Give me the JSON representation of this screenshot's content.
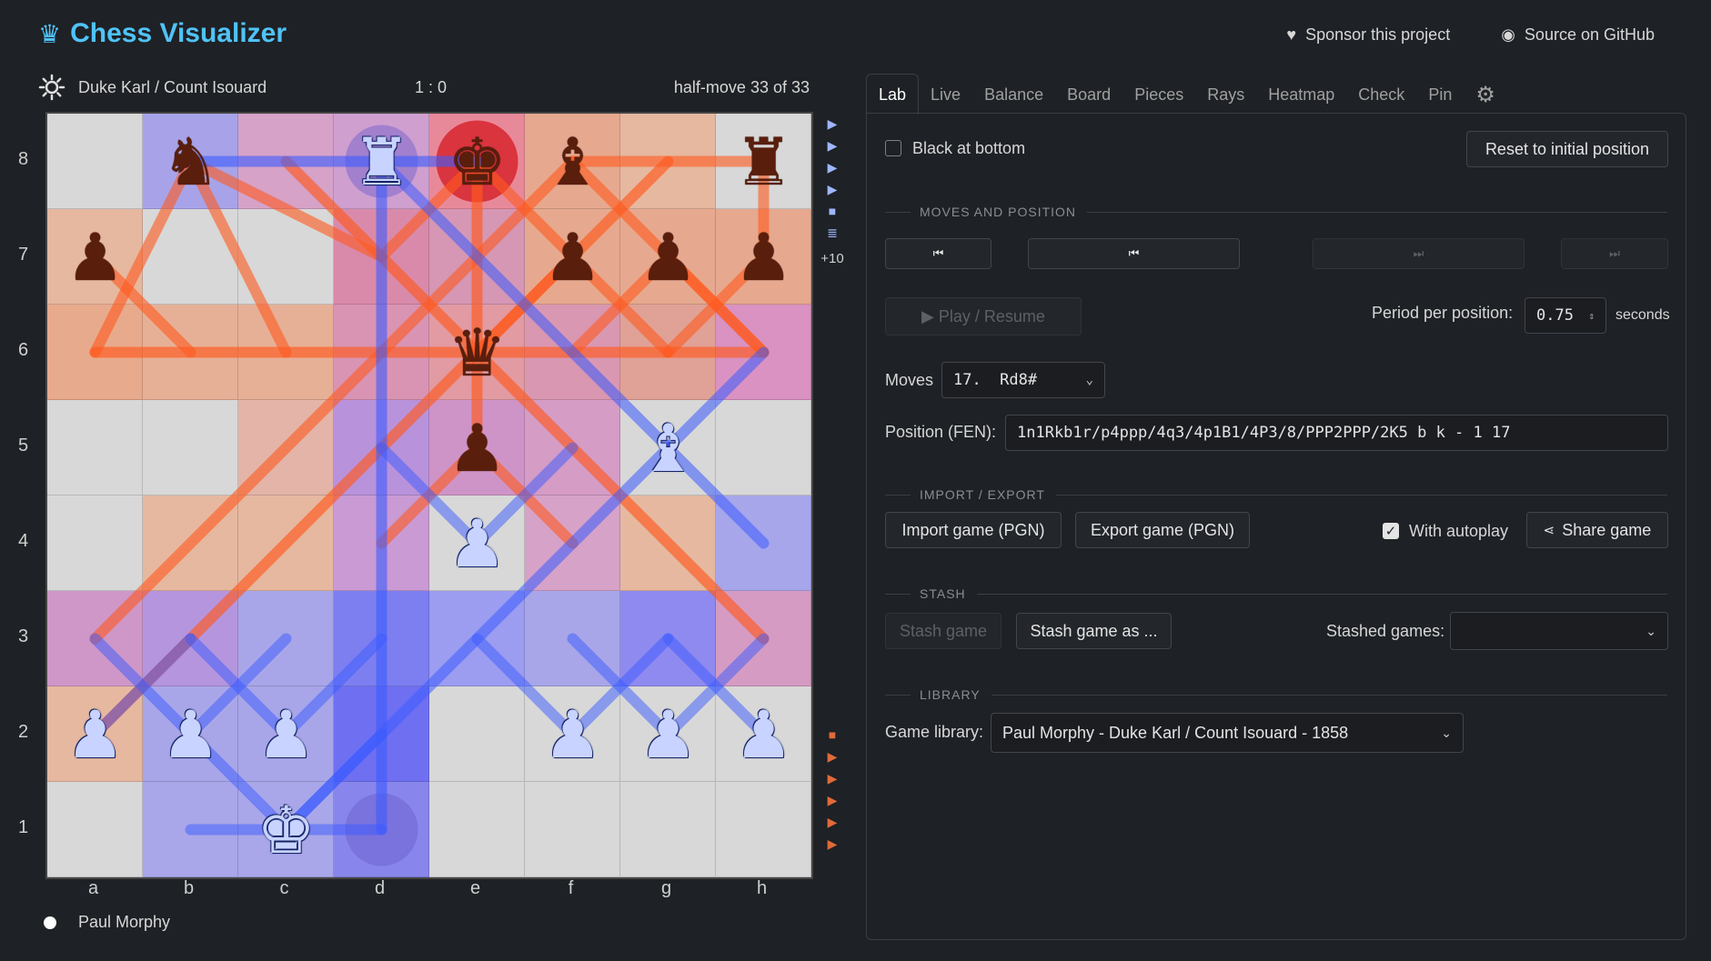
{
  "header": {
    "title": "Chess Visualizer",
    "sponsor_label": "Sponsor this project",
    "github_label": "Source on GitHub"
  },
  "game": {
    "black_player": "Duke Karl / Count Isouard",
    "score": "1 : 0",
    "half_move": "half-move 33 of 33",
    "white_player": "Paul Morphy",
    "captured_more": "+10"
  },
  "board": {
    "ranks": [
      "8",
      "7",
      "6",
      "5",
      "4",
      "3",
      "2",
      "1"
    ],
    "files": [
      "a",
      "b",
      "c",
      "d",
      "e",
      "f",
      "g",
      "h"
    ],
    "pieces": [
      {
        "sq": "b8",
        "color": "black",
        "type": "knight",
        "glyph": "♞"
      },
      {
        "sq": "d8",
        "color": "white",
        "type": "rook",
        "glyph": "♜"
      },
      {
        "sq": "e8",
        "color": "black",
        "type": "king",
        "glyph": "♚"
      },
      {
        "sq": "f8",
        "color": "black",
        "type": "bishop",
        "glyph": "♝"
      },
      {
        "sq": "h8",
        "color": "black",
        "type": "rook",
        "glyph": "♜"
      },
      {
        "sq": "a7",
        "color": "black",
        "type": "pawn",
        "glyph": "♟"
      },
      {
        "sq": "f7",
        "color": "black",
        "type": "pawn",
        "glyph": "♟"
      },
      {
        "sq": "g7",
        "color": "black",
        "type": "pawn",
        "glyph": "♟"
      },
      {
        "sq": "h7",
        "color": "black",
        "type": "pawn",
        "glyph": "♟"
      },
      {
        "sq": "e6",
        "color": "black",
        "type": "queen",
        "glyph": "♛"
      },
      {
        "sq": "e5",
        "color": "black",
        "type": "pawn",
        "glyph": "♟"
      },
      {
        "sq": "g5",
        "color": "white",
        "type": "bishop",
        "glyph": "♝"
      },
      {
        "sq": "e4",
        "color": "white",
        "type": "pawn",
        "glyph": "♟"
      },
      {
        "sq": "a2",
        "color": "white",
        "type": "pawn",
        "glyph": "♟"
      },
      {
        "sq": "b2",
        "color": "white",
        "type": "pawn",
        "glyph": "♟"
      },
      {
        "sq": "c2",
        "color": "white",
        "type": "pawn",
        "glyph": "♟"
      },
      {
        "sq": "f2",
        "color": "white",
        "type": "pawn",
        "glyph": "♟"
      },
      {
        "sq": "g2",
        "color": "white",
        "type": "pawn",
        "glyph": "♟"
      },
      {
        "sq": "h2",
        "color": "white",
        "type": "pawn",
        "glyph": "♟"
      },
      {
        "sq": "c1",
        "color": "white",
        "type": "king",
        "glyph": "♚"
      }
    ],
    "square_colors": [
      [
        "#d8d8d8",
        "#a8a3e8",
        "#d6a2c8",
        "#cf9fd0",
        "#e8899a",
        "#e6a98f",
        "#e6b8a0",
        "#d8d8d8"
      ],
      [
        "#e6b8a0",
        "#d8d8d8",
        "#d8d8d8",
        "#d98aaa",
        "#d597b4",
        "#e6a98f",
        "#e6a98f",
        "#e6a98f"
      ],
      [
        "#e8aa8c",
        "#e6b097",
        "#e6b097",
        "#d994b3",
        "#e29aa3",
        "#da97b1",
        "#e0a196",
        "#d992c1"
      ],
      [
        "#d8d8d8",
        "#d8d8d8",
        "#e3b4a7",
        "#b992dc",
        "#cf94c7",
        "#d59cc6",
        "#d8d8d8",
        "#d8d8d8"
      ],
      [
        "#d8d8d8",
        "#e6b8a0",
        "#e6b8a0",
        "#c99ad4",
        "#d8d8d8",
        "#d6a2c8",
        "#e6b8a0",
        "#a7a6ea"
      ],
      [
        "#cf97c8",
        "#b595de",
        "#a8a6e8",
        "#7d7ff0",
        "#9c9df0",
        "#a8a6e8",
        "#8f8af0",
        "#d59bc3"
      ],
      [
        "#e6b8a0",
        "#a8a6e8",
        "#a8a6e8",
        "#6f6ff2",
        "#d8d8d8",
        "#d8d8d8",
        "#d8d8d8",
        "#d8d8d8"
      ],
      [
        "#d8d8d8",
        "#a9a7e9",
        "#a9a7e9",
        "#8886ec",
        "#d8d8d8",
        "#d8d8d8",
        "#d8d8d8",
        "#d8d8d8"
      ]
    ],
    "check_square": "e8",
    "highlight_squares": [
      "d8",
      "d1"
    ]
  },
  "tabs": [
    "Lab",
    "Live",
    "Balance",
    "Board",
    "Pieces",
    "Rays",
    "Heatmap",
    "Check",
    "Pin"
  ],
  "lab": {
    "black_at_bottom_label": "Black at bottom",
    "black_at_bottom_checked": false,
    "reset_label": "Reset to initial position",
    "section_moves": "MOVES AND POSITION",
    "first_icon": "⏮",
    "prev_icon": "⏮",
    "next_icon": "⏭",
    "last_icon": "⏭",
    "play_label": "▶  Play / Resume",
    "period_label": "Period per position:",
    "period_value": "0.75",
    "seconds_label": "seconds",
    "moves_label": "Moves",
    "moves_selected": "17.  Rd8#",
    "fen_label": "Position (FEN):",
    "fen_value": "1n1Rkb1r/p4ppp/4q3/4p1B1/4P3/8/PPP2PPP/2K5 b k - 1 17",
    "section_import": "IMPORT / EXPORT",
    "import_label": "Import game (PGN)",
    "export_label": "Export game (PGN)",
    "autoplay_label": "With autoplay",
    "autoplay_checked": true,
    "share_label": "Share game",
    "section_stash": "STASH",
    "stash_label": "Stash game",
    "stash_as_label": "Stash game as ...",
    "stashed_games_label": "Stashed games:",
    "stashed_games_value": "",
    "section_library": "LIBRARY",
    "library_label": "Game library:",
    "library_value": "Paul Morphy - Duke Karl / Count Isouard - 1858"
  },
  "colors": {
    "accent": "#4fc3f7",
    "black_ray": "#ff5a1f",
    "white_ray": "#3c5cff",
    "check": "#d7262e"
  }
}
